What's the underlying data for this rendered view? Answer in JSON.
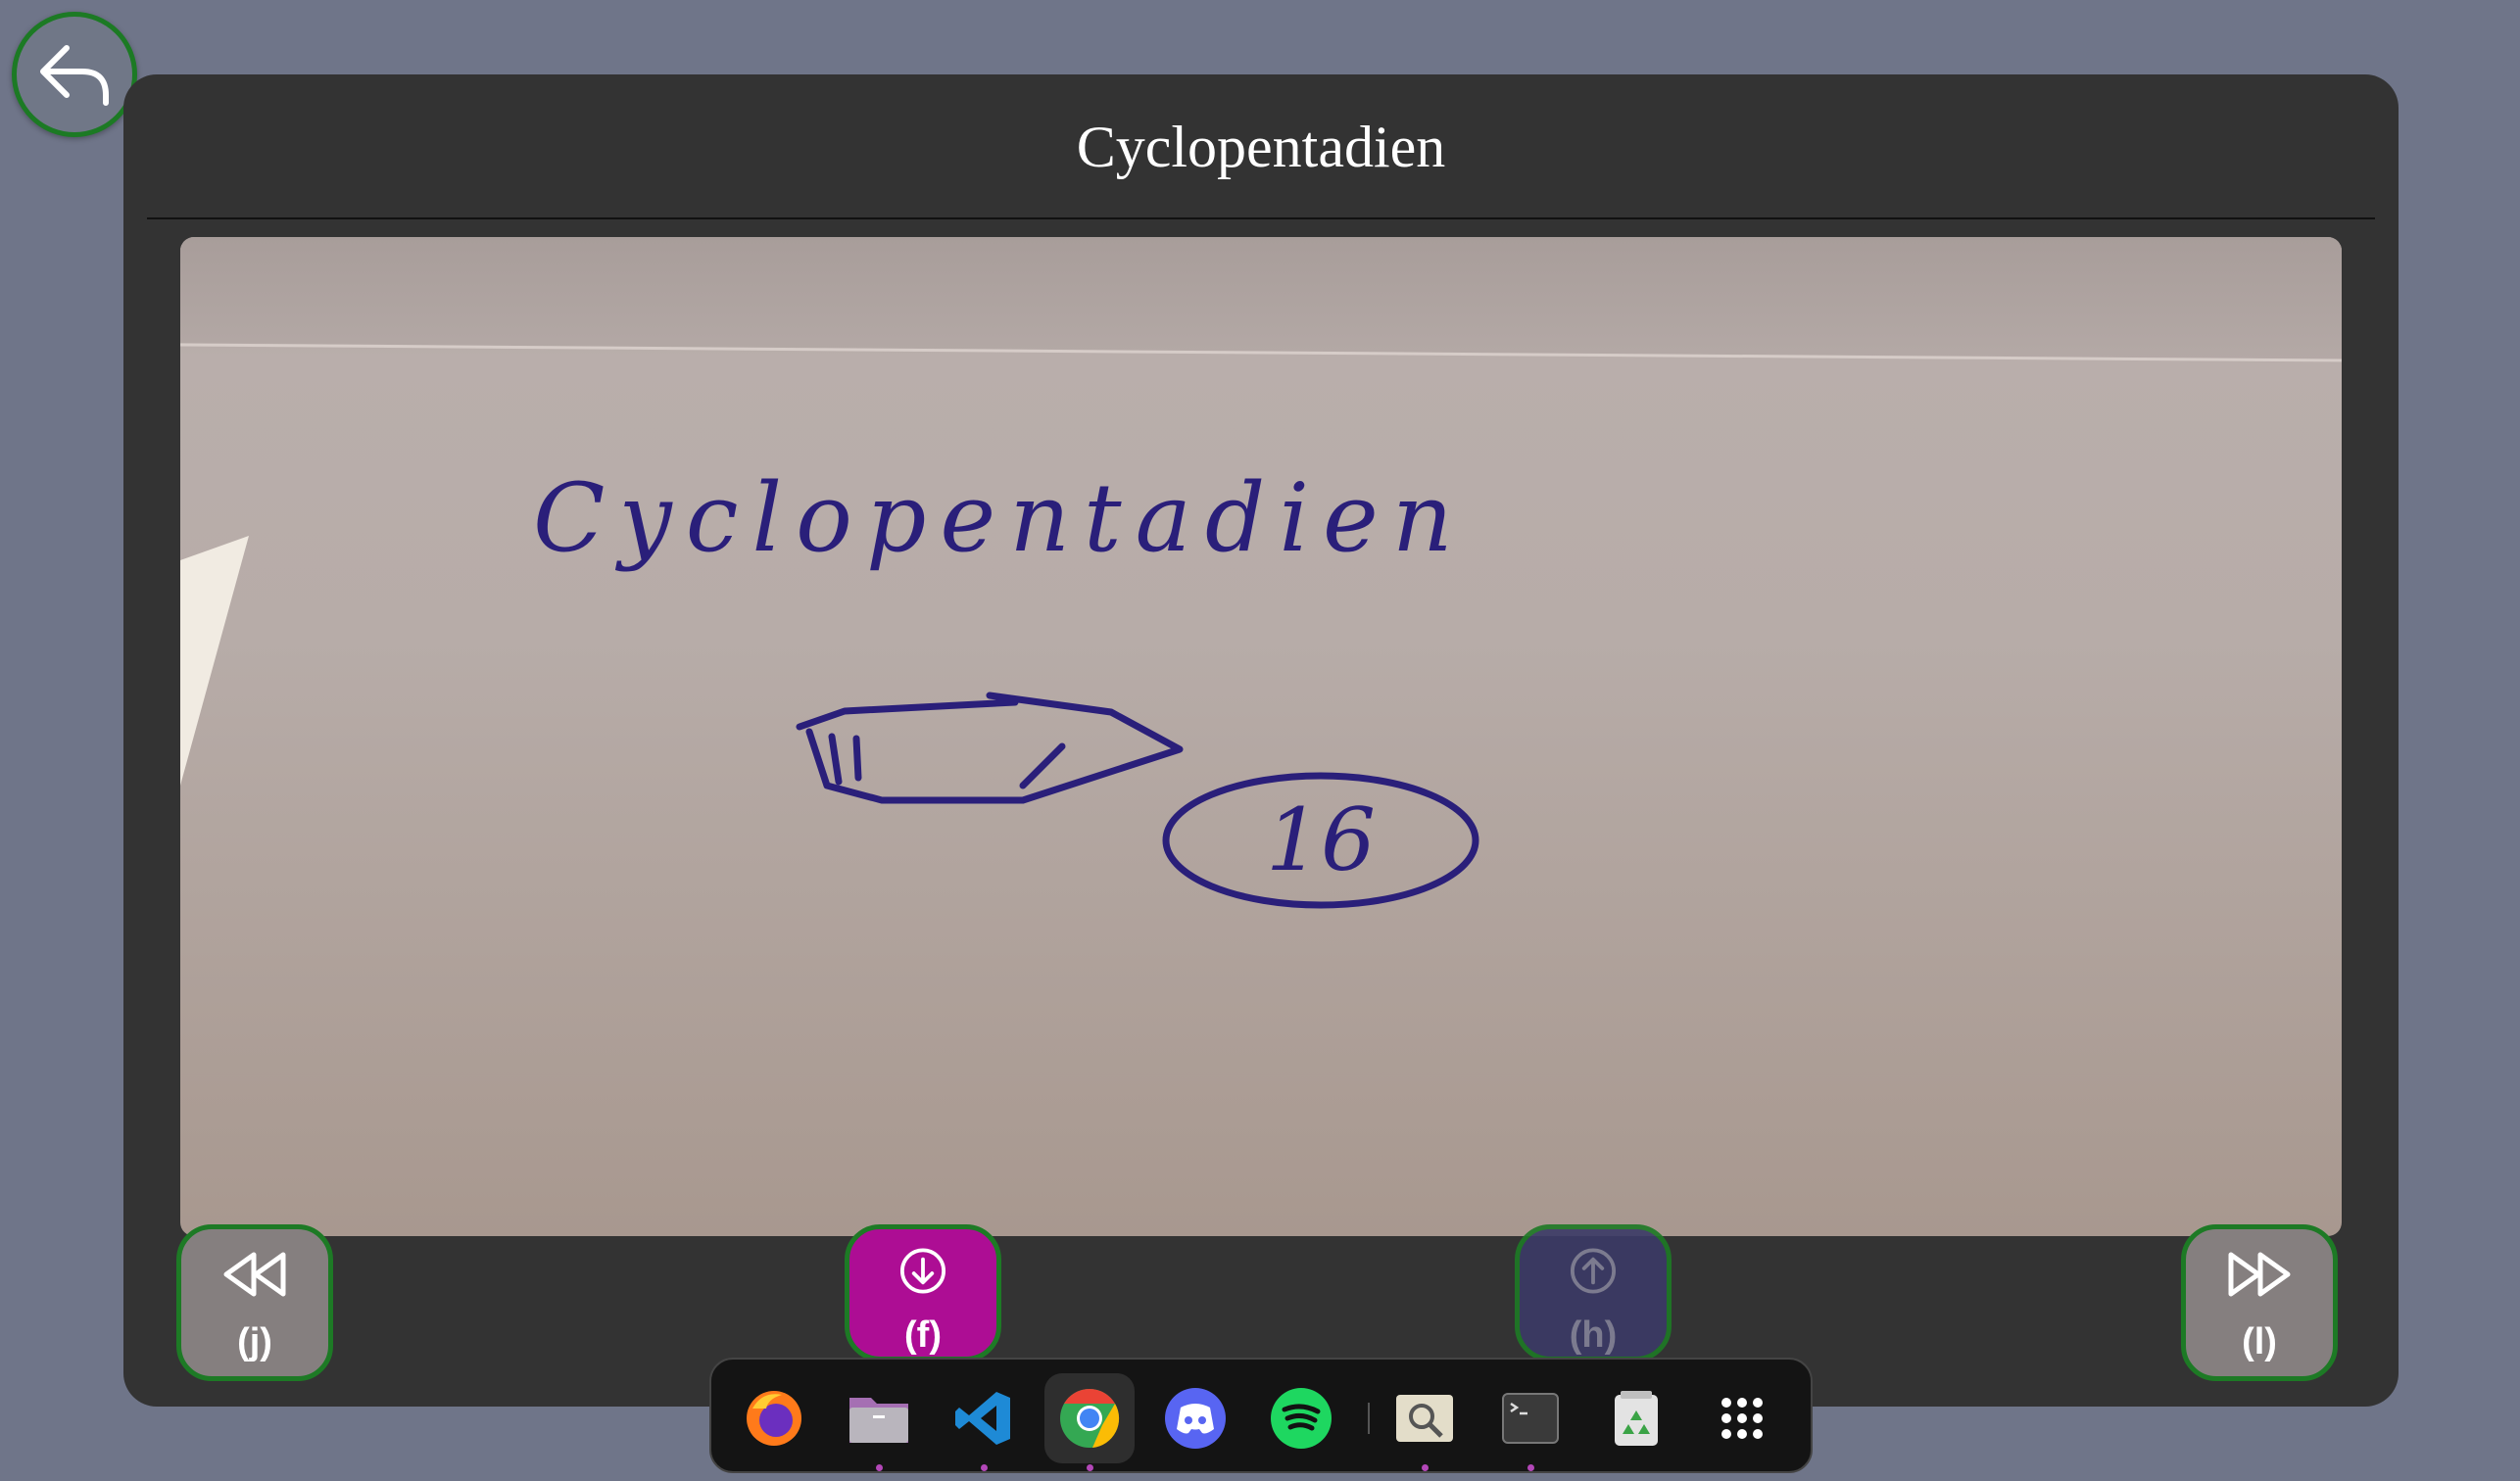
{
  "viewer": {
    "title": "Cyclopentadien",
    "handwriting_text": "Cyclopentadien",
    "badge_number": "16"
  },
  "controls": {
    "back_icon": "reply-arrow-icon",
    "previous": {
      "icon": "rewind-icon",
      "key": "(j)"
    },
    "download": {
      "icon": "arrow-down-circle-icon",
      "key": "(f)",
      "color": "#ad0d94"
    },
    "upload": {
      "icon": "arrow-up-circle-icon",
      "key": "(h)",
      "color": "#3b3a66"
    },
    "next": {
      "icon": "fast-forward-icon",
      "key": "(l)"
    }
  },
  "dock": {
    "apps": [
      {
        "name": "firefox",
        "icon": "firefox-icon",
        "running": false
      },
      {
        "name": "files",
        "icon": "folder-icon",
        "running": true
      },
      {
        "name": "vscode",
        "icon": "vscode-icon",
        "running": true
      },
      {
        "name": "chrome",
        "icon": "chrome-icon",
        "running": true,
        "active": true
      },
      {
        "name": "discord",
        "icon": "discord-icon",
        "running": false
      },
      {
        "name": "spotify",
        "icon": "spotify-icon",
        "running": false
      },
      {
        "name": "image-viewer",
        "icon": "image-search-icon",
        "running": true
      },
      {
        "name": "terminal",
        "icon": "terminal-icon",
        "running": true
      },
      {
        "name": "trash",
        "icon": "recycle-bin-icon",
        "running": false
      },
      {
        "name": "app-grid",
        "icon": "app-grid-icon",
        "running": false
      }
    ]
  },
  "colors": {
    "background": "#6f7589",
    "panel": "#333333",
    "accent_ring": "#1c7a24",
    "ink": "#2a1f7a"
  }
}
